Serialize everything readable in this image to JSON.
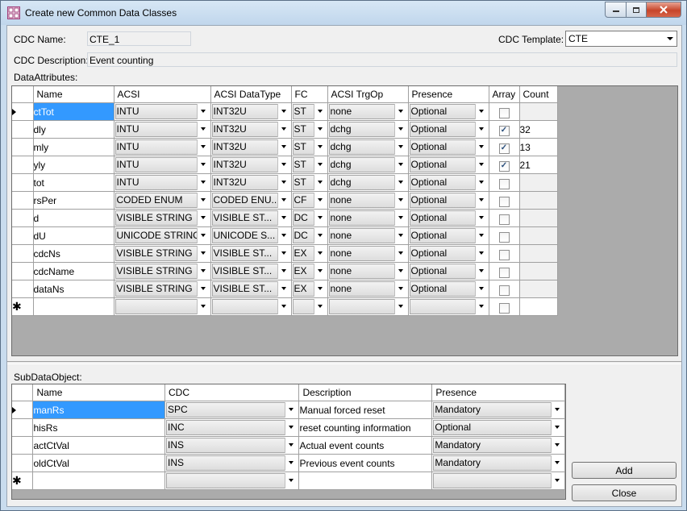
{
  "window": {
    "title": "Create new Common Data Classes"
  },
  "form": {
    "cdc_name_label": "CDC Name:",
    "cdc_name_value": "CTE_1",
    "cdc_template_label": "CDC Template:",
    "cdc_template_value": "CTE",
    "cdc_description_label": "CDC Description:",
    "cdc_description_value": "Event counting"
  },
  "data_attributes": {
    "label": "DataAttributes:",
    "columns": [
      "Name",
      "ACSI",
      "ACSI DataType",
      "FC",
      "ACSI TrgOp",
      "Presence",
      "Array",
      "Count"
    ],
    "rows": [
      {
        "name": "ctTot",
        "acsi": "INTU",
        "type": "INT32U",
        "fc": "ST",
        "trgop": "none",
        "presence": "Optional",
        "array": false,
        "count": ""
      },
      {
        "name": "dly",
        "acsi": "INTU",
        "type": "INT32U",
        "fc": "ST",
        "trgop": "dchg",
        "presence": "Optional",
        "array": true,
        "count": "32"
      },
      {
        "name": "mly",
        "acsi": "INTU",
        "type": "INT32U",
        "fc": "ST",
        "trgop": "dchg",
        "presence": "Optional",
        "array": true,
        "count": "13"
      },
      {
        "name": "yly",
        "acsi": "INTU",
        "type": "INT32U",
        "fc": "ST",
        "trgop": "dchg",
        "presence": "Optional",
        "array": true,
        "count": "21"
      },
      {
        "name": "tot",
        "acsi": "INTU",
        "type": "INT32U",
        "fc": "ST",
        "trgop": "dchg",
        "presence": "Optional",
        "array": false,
        "count": ""
      },
      {
        "name": "rsPer",
        "acsi": "CODED ENUM",
        "type": "CODED ENU...",
        "fc": "CF",
        "trgop": "none",
        "presence": "Optional",
        "array": false,
        "count": ""
      },
      {
        "name": "d",
        "acsi": "VISIBLE STRING",
        "type": "VISIBLE ST...",
        "fc": "DC",
        "trgop": "none",
        "presence": "Optional",
        "array": false,
        "count": ""
      },
      {
        "name": "dU",
        "acsi": "UNICODE STRING",
        "type": "UNICODE S...",
        "fc": "DC",
        "trgop": "none",
        "presence": "Optional",
        "array": false,
        "count": ""
      },
      {
        "name": "cdcNs",
        "acsi": "VISIBLE STRING",
        "type": "VISIBLE ST...",
        "fc": "EX",
        "trgop": "none",
        "presence": "Optional",
        "array": false,
        "count": ""
      },
      {
        "name": "cdcName",
        "acsi": "VISIBLE STRING",
        "type": "VISIBLE ST...",
        "fc": "EX",
        "trgop": "none",
        "presence": "Optional",
        "array": false,
        "count": ""
      },
      {
        "name": "dataNs",
        "acsi": "VISIBLE STRING",
        "type": "VISIBLE ST...",
        "fc": "EX",
        "trgop": "none",
        "presence": "Optional",
        "array": false,
        "count": ""
      }
    ]
  },
  "sub_data_object": {
    "label": "SubDataObject:",
    "columns": [
      "Name",
      "CDC",
      "Description",
      "Presence"
    ],
    "rows": [
      {
        "name": "manRs",
        "cdc": "SPC",
        "description": "Manual forced reset",
        "presence": "Mandatory"
      },
      {
        "name": "hisRs",
        "cdc": "INC",
        "description": "reset counting information",
        "presence": "Optional"
      },
      {
        "name": "actCtVal",
        "cdc": "INS",
        "description": "Actual event counts",
        "presence": "Mandatory"
      },
      {
        "name": "oldCtVal",
        "cdc": "INS",
        "description": "Previous event counts",
        "presence": "Mandatory"
      }
    ]
  },
  "buttons": {
    "add": "Add",
    "close": "Close"
  },
  "colors": {
    "selection": "#3399ff",
    "titlebar": "#c9dcee",
    "close_button": "#c7452a"
  }
}
